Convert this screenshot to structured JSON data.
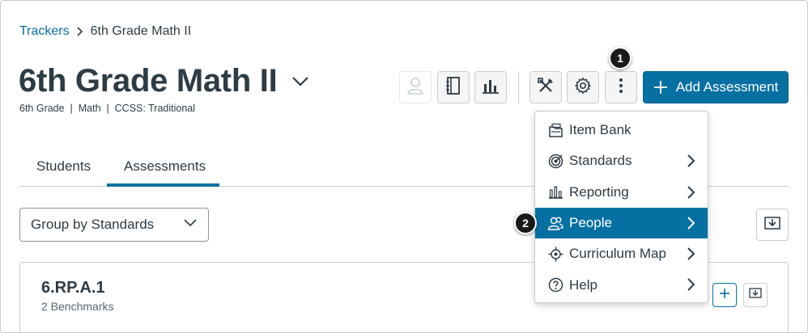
{
  "breadcrumb": {
    "parent": "Trackers",
    "current": "6th Grade Math II"
  },
  "header": {
    "title": "6th Grade Math II",
    "subtitle": "6th Grade  |  Math  |  CCSS: Traditional",
    "add_button_label": "Add Assessment",
    "toolbar_icons": [
      "student-view-icon",
      "notebook-icon",
      "bar-chart-icon",
      "tools-icon",
      "gear-icon",
      "more-options-icon"
    ]
  },
  "badges": {
    "first": "1",
    "second": "2"
  },
  "tabs": [
    {
      "label": "Students",
      "active": false
    },
    {
      "label": "Assessments",
      "active": true
    }
  ],
  "group_select": {
    "value": "Group by Standards"
  },
  "card": {
    "title": "6.RP.A.1",
    "subtitle": "2 Benchmarks"
  },
  "menu": {
    "items": [
      {
        "label": "Item Bank",
        "icon": "item-bank-icon",
        "submenu": false
      },
      {
        "label": "Standards",
        "icon": "standards-icon",
        "submenu": true
      },
      {
        "label": "Reporting",
        "icon": "reporting-icon",
        "submenu": true
      },
      {
        "label": "People",
        "icon": "people-icon",
        "submenu": true,
        "active": true
      },
      {
        "label": "Curriculum Map",
        "icon": "curriculum-map-icon",
        "submenu": true
      },
      {
        "label": "Help",
        "icon": "help-icon",
        "submenu": true
      }
    ]
  },
  "colors": {
    "accent": "#0770a3",
    "text": "#2d3b45",
    "border": "#c7cdd1"
  }
}
